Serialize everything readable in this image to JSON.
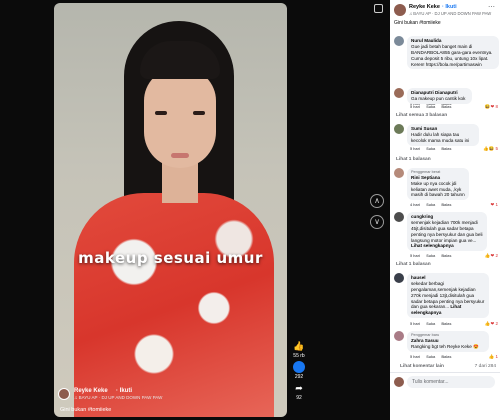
{
  "video": {
    "caption_overlay": "makeup sesuai umur",
    "author": "Reyke Keke",
    "follow": "· Ikuti",
    "music": "♫ BAYU AP · DJ UP AND DOWN PAW PAW",
    "caption": "Gini bukan #tomiieke"
  },
  "side_actions": {
    "likes": "55 rb",
    "comments": "292",
    "shares": "92"
  },
  "panel": {
    "author": "Reyke Keke",
    "follow": "· Ikuti",
    "music": "♫ BAYU AP · DJ UP AND DOWN PAW PAW",
    "caption": "Gini bukan #tomiieke",
    "comments": [
      {
        "name": "Nurul Maulida",
        "text": "Gue jadi betah banget main di BANDARBOLA855 gara-gara eventnya. Cuma deposit 5 ribu, untung 10x lipat. Keren! https://bola.me/partimaswin",
        "time": "5 hari",
        "like": "Suka",
        "reply": "Balas"
      },
      {
        "name": "Dianaputri Dianaputri",
        "text": "Ga makeup pun cantik kok",
        "time": "5 hari",
        "like": "Suka",
        "reply": "Balas",
        "replies": "Lihat semua 3 balasan"
      },
      {
        "name": "Sumi Susan",
        "text": "Hadir dulu lah siapa tau kecolok mama muda satu ini",
        "time": "5 hari",
        "like": "Suka",
        "reply": "Balas",
        "replies": "Lihat 1 balasan"
      },
      {
        "badge": "Penggemar berat",
        "name": "Rini Septiana",
        "text": "Make up nya cocok jdi keliatan awet muda, ,kyk masih di bawah 20 tahunn",
        "time": "4 hari",
        "like": "Suka",
        "reply": "Balas"
      },
      {
        "name": "cungkring",
        "text": "semenjak kejadian 700k menjadi 45jt,disitulah gua sadar betapa penting nya bersyukur dan gua beli langsung motor impian gua ve...",
        "see_more": "Lihat selengkapnya",
        "time": "5 hari",
        "like": "Suka",
        "reply": "Balas",
        "replies": "Lihat 1 balasan"
      },
      {
        "name": "hausel",
        "text": "sekedar berbagi pengalaman,semenjak kejadian 270k menjadi 13jt,disitulah gua sadar betapa penting nya bersyukur dan gua sekaran... ",
        "see_more": "Lihat selengkapnya",
        "time": "5 hari",
        "like": "Suka",
        "reply": "Balas"
      },
      {
        "badge": "Penggemar baru",
        "name": "Zahra Sasuu",
        "text": "Rangking bgt teh Reyke Keke 😍",
        "time": "5 hari",
        "like": "Suka",
        "reply": "Balas"
      }
    ],
    "more_comments": "Lihat komentar lain",
    "count": "7 dari 284",
    "comment_placeholder": "Tulis komentar..."
  }
}
